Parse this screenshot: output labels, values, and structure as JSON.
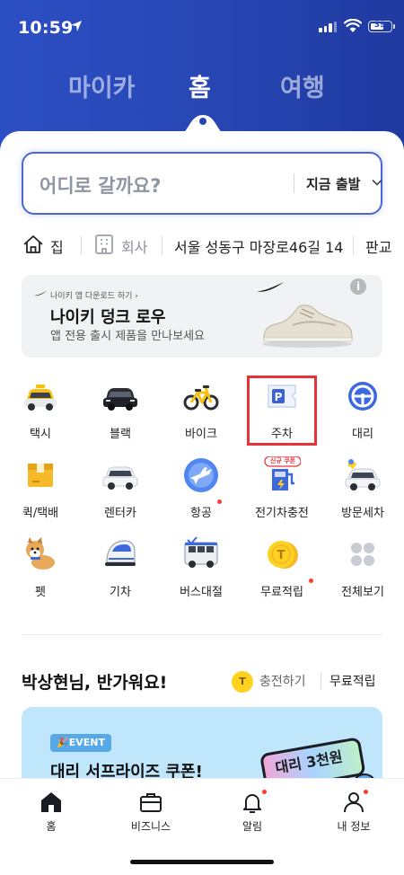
{
  "status": {
    "time": "10:59",
    "battery": "39"
  },
  "main_tabs": [
    "마이카",
    "홈",
    "여행"
  ],
  "search": {
    "placeholder": "어디로 갈까요?",
    "departure": "지금 출발"
  },
  "places": [
    "집",
    "회사",
    "서울 성동구 마장로46길 14",
    "판교"
  ],
  "ad": {
    "small": "나이키 앱 다운로드 하기 ›",
    "title": "나이키 덩크 로우",
    "subtitle": "앱 전용 출시 제품을 만나보세요",
    "info_icon": "i"
  },
  "services": [
    {
      "label": "택시",
      "icon": "taxi-icon"
    },
    {
      "label": "블랙",
      "icon": "black-car-icon"
    },
    {
      "label": "바이크",
      "icon": "bike-icon"
    },
    {
      "label": "주차",
      "icon": "parking-icon",
      "highlighted": true
    },
    {
      "label": "대리",
      "icon": "driver-wheel-icon"
    },
    {
      "label": "퀵/택배",
      "icon": "delivery-box-icon"
    },
    {
      "label": "렌터카",
      "icon": "rental-car-icon"
    },
    {
      "label": "항공",
      "icon": "airplane-icon",
      "dot": true
    },
    {
      "label": "전기차충전",
      "icon": "ev-charge-icon",
      "badge": "신규 쿠폰"
    },
    {
      "label": "방문세차",
      "icon": "car-wash-icon"
    },
    {
      "label": "펫",
      "icon": "pet-icon"
    },
    {
      "label": "기차",
      "icon": "train-icon"
    },
    {
      "label": "버스대절",
      "icon": "bus-icon"
    },
    {
      "label": "무료적립",
      "icon": "coin-icon",
      "dot": true
    },
    {
      "label": "전체보기",
      "icon": "all-view-icon"
    }
  ],
  "greeting": {
    "text": "박상현님, 반가워요!",
    "coin": "T",
    "charge": "충전하기",
    "free": "무료적립"
  },
  "event": {
    "badge": "🎉EVENT",
    "title": "대리 서프라이즈 쿠폰!",
    "ticket_text": "대리 3천원"
  },
  "nav": [
    {
      "label": "홈",
      "icon": "home-icon"
    },
    {
      "label": "비즈니스",
      "icon": "briefcase-icon"
    },
    {
      "label": "알림",
      "icon": "bell-icon",
      "dot": true
    },
    {
      "label": "내 정보",
      "icon": "profile-icon",
      "dot": true
    }
  ],
  "colors": {
    "brand_blue": "#2746b3",
    "highlight_red": "#e8323a",
    "dot_red": "#ff3b30"
  }
}
